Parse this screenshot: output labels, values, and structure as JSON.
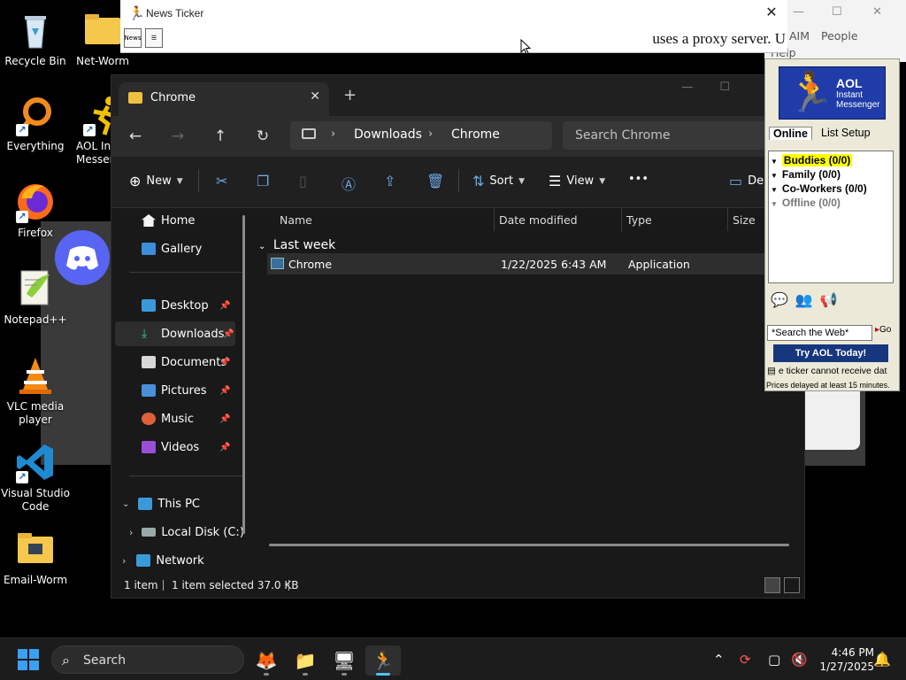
{
  "desktop": {
    "icons": [
      {
        "label": "Recycle Bin"
      },
      {
        "label": "Net-Worm"
      },
      {
        "label": "Everything"
      },
      {
        "label": "AOL Ins Messen"
      },
      {
        "label": "Firefox"
      },
      {
        "label": "Notepad++"
      },
      {
        "label": "VLC media player"
      },
      {
        "label": "Visual Studio Code"
      },
      {
        "label": "Email-Worm"
      }
    ]
  },
  "news_ticker": {
    "title": "News Ticker",
    "tool1": "News",
    "scroll_text": "uses a proxy server.  U"
  },
  "explorer": {
    "tab_label": "Chrome",
    "breadcrumb": [
      "Downloads",
      "Chrome"
    ],
    "search_placeholder": "Search Chrome",
    "commands": {
      "new": "New",
      "sort": "Sort",
      "view": "View",
      "more": "•••",
      "details": "De"
    },
    "sidebar": {
      "items": [
        {
          "label": "Home"
        },
        {
          "label": "Gallery"
        },
        {
          "label": "Desktop"
        },
        {
          "label": "Downloads"
        },
        {
          "label": "Documents"
        },
        {
          "label": "Pictures"
        },
        {
          "label": "Music"
        },
        {
          "label": "Videos"
        },
        {
          "label": "This PC"
        },
        {
          "label": "Local Disk (C:)"
        },
        {
          "label": "Network"
        }
      ]
    },
    "columns": [
      "Name",
      "Date modified",
      "Type",
      "Size"
    ],
    "group": "Last week",
    "files": [
      {
        "name": "Chrome",
        "date": "1/22/2025 6:43 AM",
        "type": "Application"
      }
    ],
    "status": {
      "count": "1 item",
      "selected": "1 item selected  37.0 KB"
    }
  },
  "aim": {
    "top_menu": {
      "aim": "AIM",
      "people": "People",
      "help": "Help"
    },
    "logo": {
      "line1": "AOL",
      "line2": "Instant\nMessenger"
    },
    "tabs": {
      "online": "Online",
      "list_setup": "List Setup"
    },
    "groups": [
      {
        "label": "Buddies (0/0)"
      },
      {
        "label": "Family (0/0)"
      },
      {
        "label": "Co-Workers (0/0)"
      },
      {
        "label": "Offline (0/0)"
      }
    ],
    "search_value": "*Search the Web*",
    "go": "Go",
    "banner": "Try AOL Today!",
    "ticker_text": "e ticker cannot receive dat",
    "delay_note": "Prices delayed at least 15 minutes."
  },
  "taskbar": {
    "search_label": "Search",
    "time": "4:46 PM",
    "date": "1/27/2025"
  },
  "colors": {
    "accent": "#4cc2ff",
    "highlight_yellow": "#ffff00",
    "aol_blue": "#1f3ca8"
  }
}
